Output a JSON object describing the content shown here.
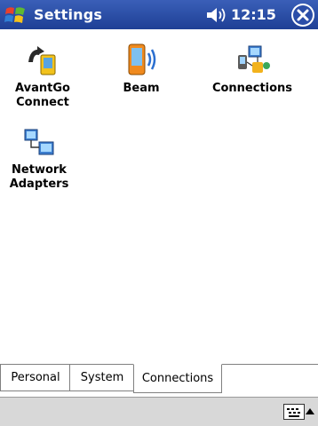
{
  "titlebar": {
    "title": "Settings",
    "time": "12:15"
  },
  "icons": [
    {
      "label_line1": "AvantGo",
      "label_line2": "Connect",
      "icon": "avantgo-icon"
    },
    {
      "label_line1": "Beam",
      "label_line2": "",
      "icon": "beam-icon"
    },
    {
      "label_line1": "Connections",
      "label_line2": "",
      "icon": "connections-icon"
    },
    {
      "label_line1": "Network",
      "label_line2": "Adapters",
      "icon": "network-adapters-icon"
    }
  ],
  "tabs": [
    {
      "label": "Personal",
      "active": false
    },
    {
      "label": "System",
      "active": false
    },
    {
      "label": "Connections",
      "active": true
    }
  ],
  "colors": {
    "titlebar": "#1e3f95",
    "menubar": "#d8d8d8"
  }
}
